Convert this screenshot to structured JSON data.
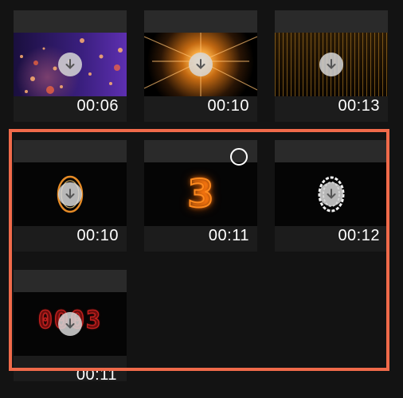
{
  "grid": {
    "items": [
      {
        "duration": "00:06",
        "style": "particles-purple",
        "icon": "download-icon"
      },
      {
        "duration": "00:10",
        "style": "sunburst-orange",
        "icon": "download-icon"
      },
      {
        "duration": "00:13",
        "style": "golden-rain",
        "icon": "download-icon"
      },
      {
        "duration": "00:10",
        "style": "fire-ring",
        "icon": "download-icon"
      },
      {
        "duration": "00:11",
        "style": "neon-three",
        "glyph": "3",
        "icon": "select-circle-icon"
      },
      {
        "duration": "00:12",
        "style": "white-swirl",
        "icon": "download-icon"
      },
      {
        "duration": "00:11",
        "style": "led-counter",
        "glyph": "0003",
        "icon": "download-icon"
      }
    ]
  },
  "colors": {
    "background": "#131313",
    "card": "#1c1c1c",
    "highlight_border": "#f06a4a",
    "neon_orange": "#ff8a1e",
    "led_red": "#c0201e"
  }
}
